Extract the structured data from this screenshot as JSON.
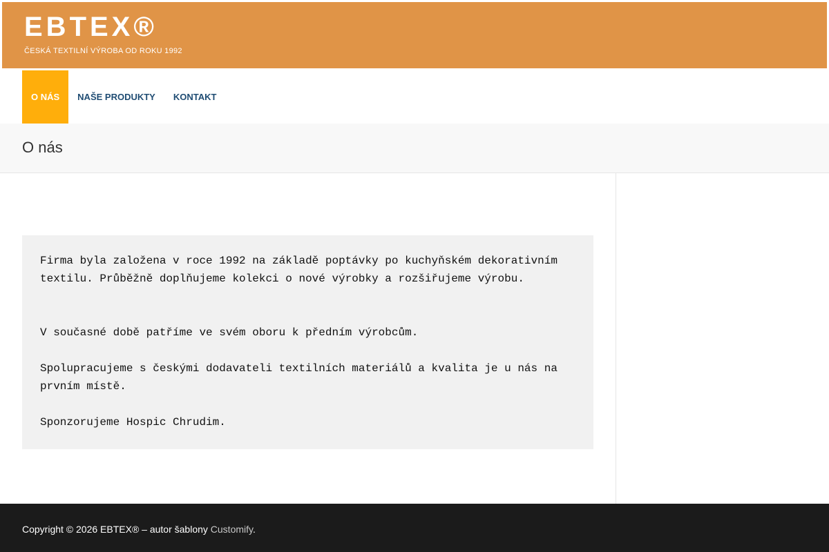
{
  "header": {
    "site_title": "EBTEX®",
    "tagline": "ČESKÁ TEXTILNÍ VÝROBA OD ROKU 1992",
    "bg_color": "#e09447"
  },
  "nav": {
    "items": [
      {
        "label": "O NÁS",
        "active": true
      },
      {
        "label": "NAŠE PRODUKTY",
        "active": false
      },
      {
        "label": "KONTAKT",
        "active": false
      }
    ],
    "active_color": "#ffae0b",
    "link_color": "#1f4c73"
  },
  "page": {
    "title": "O nás"
  },
  "content": {
    "paragraphs": [
      "Firma byla založena v roce 1992 na základě poptávky po kuchyňském dekorativním textilu. Průběžně doplňujeme kolekci o nové výrobky a rozšiřujeme výrobu.",
      "V současné době patříme ve svém oboru k předním výrobcům.",
      "Spolupracujeme s českými dodavateli textilních materiálů a kvalita je u nás na prvním místě.",
      "Sponzorujeme Hospic Chrudim."
    ]
  },
  "footer": {
    "copyright": "Copyright © 2026 EBTEX® – autor šablony ",
    "link_label": "Customify",
    "suffix": "."
  }
}
